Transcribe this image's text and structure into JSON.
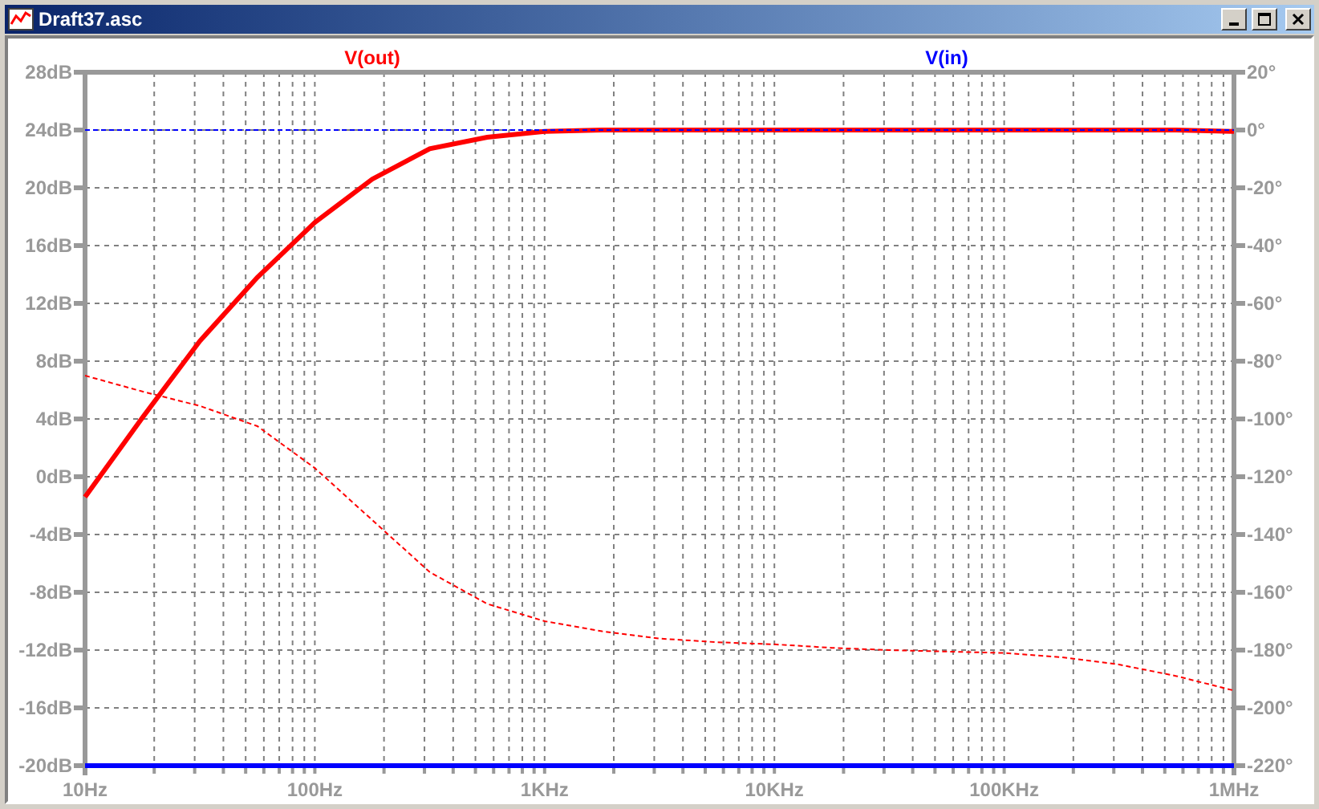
{
  "window": {
    "title": "Draft37.asc"
  },
  "plot": {
    "chart_data": {
      "type": "line",
      "grid": true,
      "ylim": [
        -20,
        28
      ],
      "categories": [
        "10Hz",
        null,
        null,
        null,
        "100Hz",
        null,
        null,
        null,
        "1KHz",
        null,
        null,
        null,
        "10KHz",
        null,
        null,
        null,
        "100KHz",
        null,
        null,
        null,
        "1MHz"
      ],
      "yticks": [
        {
          "value": 28,
          "label": "28dB"
        },
        {
          "value": 24,
          "label": "24dB"
        },
        {
          "value": 20,
          "label": "20dB"
        },
        {
          "value": 16,
          "label": "16dB"
        },
        {
          "value": 12,
          "label": "12dB"
        },
        {
          "value": 8,
          "label": "8dB"
        },
        {
          "value": 4,
          "label": "4dB"
        },
        {
          "value": 0,
          "label": "0dB"
        },
        {
          "value": -4,
          "label": "-4dB"
        },
        {
          "value": -8,
          "label": "-8dB"
        },
        {
          "value": -12,
          "label": "-12dB"
        },
        {
          "value": -16,
          "label": "-16dB"
        },
        {
          "value": -20,
          "label": "-20dB"
        }
      ],
      "series": [
        {
          "name": "V(out)",
          "color": "#ff0000",
          "values": [
            -1.4,
            4.1,
            9.4,
            13.8,
            17.6,
            20.6,
            22.7,
            23.5,
            23.9,
            24,
            24,
            24,
            24,
            24,
            24,
            24,
            24,
            24,
            24,
            24,
            23.9
          ]
        },
        {
          "name": "V(in)",
          "color": "#0000ff",
          "values": [
            -20,
            -20,
            -20,
            -20,
            -20,
            -20,
            -20,
            -20,
            -20,
            -20,
            -20,
            -20,
            -20,
            -20,
            -20,
            -20,
            -20,
            -20,
            -20,
            -20,
            -20
          ]
        }
      ]
    }
  },
  "phase_plot": {
    "chart_data": {
      "type": "line",
      "ylim": [
        -220,
        20
      ],
      "categories": [
        null,
        null,
        null,
        null,
        null,
        null,
        null,
        null,
        null,
        null,
        null,
        null,
        null,
        null,
        null,
        null,
        null,
        null,
        null,
        null,
        null
      ],
      "yticks": [
        {
          "value": 20,
          "label": "20°"
        },
        {
          "value": 0,
          "label": "0°"
        },
        {
          "value": -20,
          "label": "-20°"
        },
        {
          "value": -40,
          "label": "-40°"
        },
        {
          "value": -60,
          "label": "-60°"
        },
        {
          "value": -80,
          "label": "-80°"
        },
        {
          "value": -100,
          "label": "-100°"
        },
        {
          "value": -120,
          "label": "-120°"
        },
        {
          "value": -140,
          "label": "-140°"
        },
        {
          "value": -160,
          "label": "-160°"
        },
        {
          "value": -180,
          "label": "-180°"
        },
        {
          "value": -200,
          "label": "-200°"
        },
        {
          "value": -220,
          "label": "-220°"
        }
      ],
      "series": [
        {
          "color": "#ff0000",
          "line_style": "dashed",
          "values": [
            -85,
            -90.5,
            -95.5,
            -102.5,
            -117,
            -135,
            -153,
            -164,
            -170,
            -173.5,
            -176,
            -177.3,
            -178,
            -179.2,
            -180,
            -180.5,
            -181,
            -182.5,
            -185,
            -189,
            -194
          ]
        },
        {
          "color": "#0000ff",
          "line_style": "dashed",
          "values": [
            0,
            0,
            0,
            0,
            0,
            0,
            0,
            0,
            0,
            0,
            0,
            0,
            0,
            0,
            0,
            0,
            0,
            0,
            0,
            0,
            0
          ]
        }
      ]
    }
  }
}
